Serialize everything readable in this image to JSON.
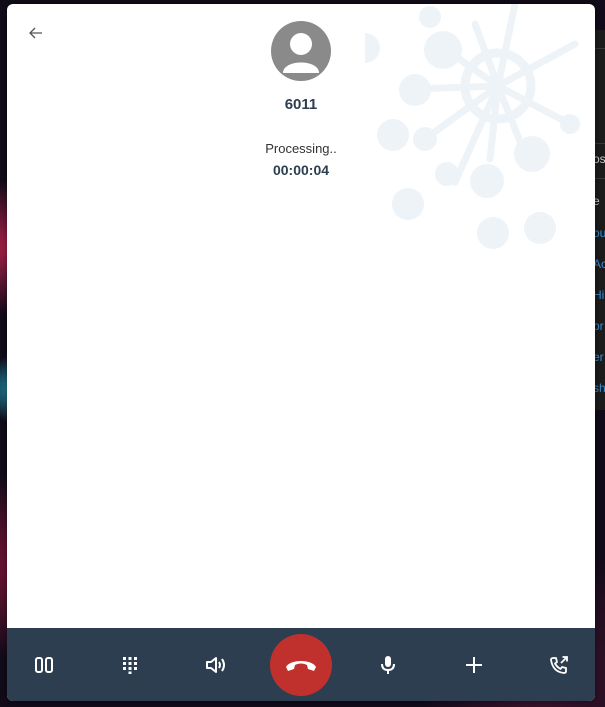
{
  "call": {
    "number": "6011",
    "status": "Processing..",
    "duration": "00:00:04"
  },
  "icons": {
    "back": "arrow-left-icon",
    "avatar": "user-avatar-icon",
    "hold": "pause-icon",
    "keypad": "dialpad-icon",
    "speaker": "speaker-icon",
    "hangup": "phone-hangup-icon",
    "mute": "microphone-icon",
    "add": "plus-icon",
    "transfer": "call-transfer-icon"
  },
  "colors": {
    "bar": "#2c3e50",
    "hangup": "#c0312e",
    "text": "#2c3e50",
    "decoration": "#eef3f8"
  },
  "background_app": {
    "items": [
      "os",
      "e",
      "ou",
      "Ac",
      "Hi",
      "pr",
      "er",
      "sh"
    ]
  }
}
